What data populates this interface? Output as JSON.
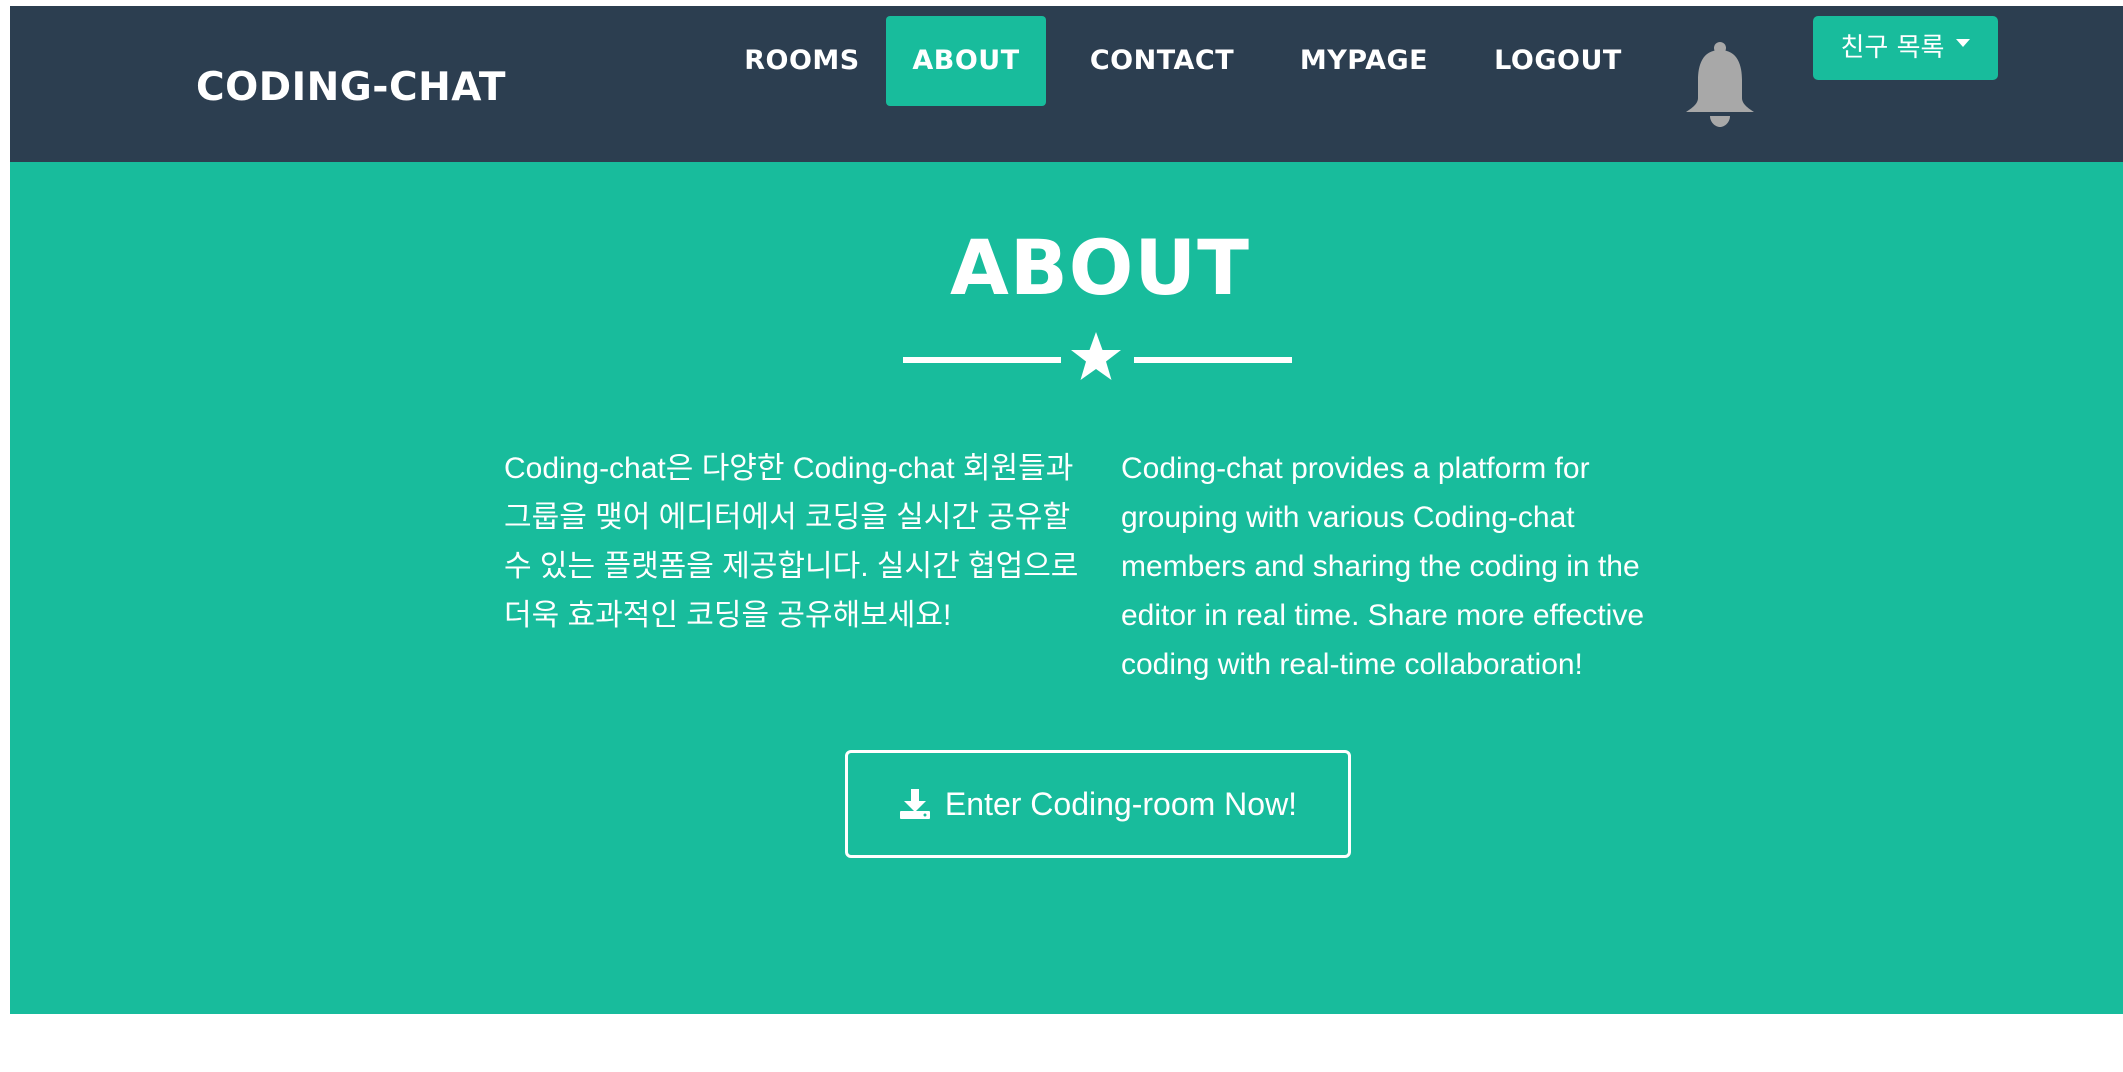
{
  "navbar": {
    "brand": "CODING-CHAT",
    "items": [
      {
        "label": "ROOMS",
        "active": false
      },
      {
        "label": "ABOUT",
        "active": true
      },
      {
        "label": "CONTACT",
        "active": false
      },
      {
        "label": "MYPAGE",
        "active": false
      },
      {
        "label": "LOGOUT",
        "active": false
      }
    ],
    "notification_icon": "bell-icon",
    "friends_dropdown": {
      "label": "친구 목록",
      "icon": "caret-down-icon"
    }
  },
  "hero": {
    "title": "ABOUT",
    "divider_icon": "star-icon",
    "text_korean": "Coding-chat은 다양한 Coding-chat 회원들과 그룹을 맺어 에디터에서 코딩을 실시간 공유할 수 있는 플랫폼을 제공합니다. 실시간 협업으로 더욱 효과적인 코딩을 공유해보세요!",
    "text_english": "Coding-chat provides a platform for grouping with various Coding-chat members and sharing the coding in the editor in real time. Share more effective coding with real-time collaboration!",
    "cta_label": "Enter Coding-room Now!",
    "cta_icon": "download-icon"
  },
  "colors": {
    "navbar_bg": "#2c3e50",
    "accent": "#18bc9c",
    "text": "#ffffff",
    "bell": "#a8a8a8"
  }
}
